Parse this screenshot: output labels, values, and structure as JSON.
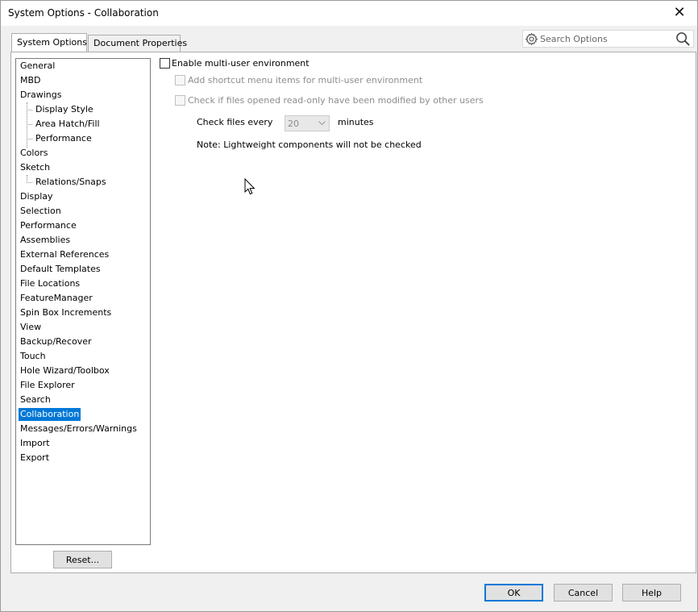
{
  "window": {
    "title": "System Options - Collaboration",
    "close_glyph": "✕"
  },
  "tabs": [
    {
      "label": "System Options",
      "active": true
    },
    {
      "label": "Document Properties",
      "active": false
    }
  ],
  "search": {
    "placeholder": "Search Options",
    "icons": [
      "gear-icon",
      "search-icon"
    ]
  },
  "tree": {
    "selected": "Collaboration",
    "items": [
      {
        "label": "General",
        "level": 0
      },
      {
        "label": "MBD",
        "level": 0
      },
      {
        "label": "Drawings",
        "level": 0
      },
      {
        "label": "Display Style",
        "level": 1
      },
      {
        "label": "Area Hatch/Fill",
        "level": 1
      },
      {
        "label": "Performance",
        "level": 1
      },
      {
        "label": "Colors",
        "level": 0
      },
      {
        "label": "Sketch",
        "level": 0
      },
      {
        "label": "Relations/Snaps",
        "level": 1
      },
      {
        "label": "Display",
        "level": 0
      },
      {
        "label": "Selection",
        "level": 0
      },
      {
        "label": "Performance",
        "level": 0
      },
      {
        "label": "Assemblies",
        "level": 0
      },
      {
        "label": "External References",
        "level": 0
      },
      {
        "label": "Default Templates",
        "level": 0
      },
      {
        "label": "File Locations",
        "level": 0
      },
      {
        "label": "FeatureManager",
        "level": 0
      },
      {
        "label": "Spin Box Increments",
        "level": 0
      },
      {
        "label": "View",
        "level": 0
      },
      {
        "label": "Backup/Recover",
        "level": 0
      },
      {
        "label": "Touch",
        "level": 0
      },
      {
        "label": "Hole Wizard/Toolbox",
        "level": 0
      },
      {
        "label": "File Explorer",
        "level": 0
      },
      {
        "label": "Search",
        "level": 0
      },
      {
        "label": "Collaboration",
        "level": 0
      },
      {
        "label": "Messages/Errors/Warnings",
        "level": 0
      },
      {
        "label": "Import",
        "level": 0
      },
      {
        "label": "Export",
        "level": 0
      }
    ]
  },
  "options": {
    "enable_multiuser": {
      "label": "Enable multi-user environment",
      "checked": false,
      "enabled": true
    },
    "add_shortcut": {
      "label": "Add shortcut menu items for multi-user environment",
      "checked": false,
      "enabled": false
    },
    "check_readonly": {
      "label": "Check if files opened read-only have been modified by other users",
      "checked": false,
      "enabled": false
    },
    "check_every": {
      "label": "Check files every",
      "value": "20",
      "unit": "minutes"
    },
    "note": "Note: Lightweight components will not be checked"
  },
  "buttons": {
    "reset": "Reset...",
    "ok": "OK",
    "cancel": "Cancel",
    "help": "Help"
  },
  "colors": {
    "selection": "#0078d7",
    "default_button_border": "#0078d7",
    "dialog_bg": "#f0f0f0"
  }
}
